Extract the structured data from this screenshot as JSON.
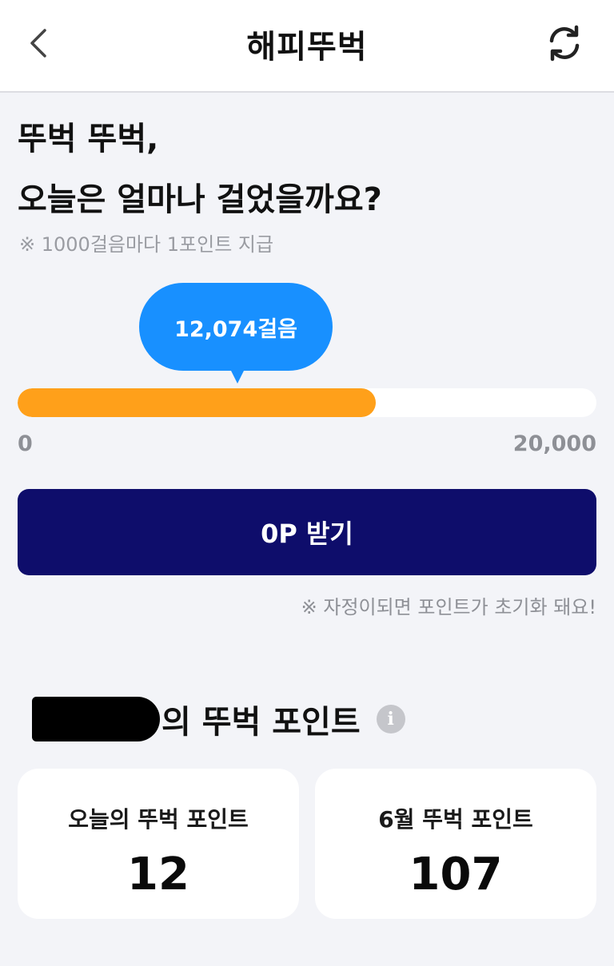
{
  "header": {
    "title": "해피뚜벅",
    "back_icon": "chevron-left-icon",
    "refresh_icon": "refresh-icon"
  },
  "main": {
    "headline_line1": "뚜벅 뚜벅,",
    "headline_line2": "오늘은 얼마나 걸었을까요?",
    "notice": "※ 1000걸음마다 1포인트 지급",
    "steps_label": "12,074걸음",
    "progress": {
      "current": 12074,
      "max": 20000,
      "min_label": "0",
      "max_label": "20,000"
    },
    "claim_button": "0P 받기",
    "reset_note": "※ 자정이되면 포인트가 초기화 돼요!"
  },
  "points": {
    "section_title_suffix": "의 뚜벅 포인트",
    "info_icon_glyph": "i",
    "today_label": "오늘의 뚜벅 포인트",
    "today_value": "12",
    "month_label": "6월 뚜벅 포인트",
    "month_value": "107"
  },
  "colors": {
    "bubble": "#1890ff",
    "progress_fill": "#ffa01a",
    "button": "#0e0d6b",
    "background": "#f3f4f8"
  }
}
